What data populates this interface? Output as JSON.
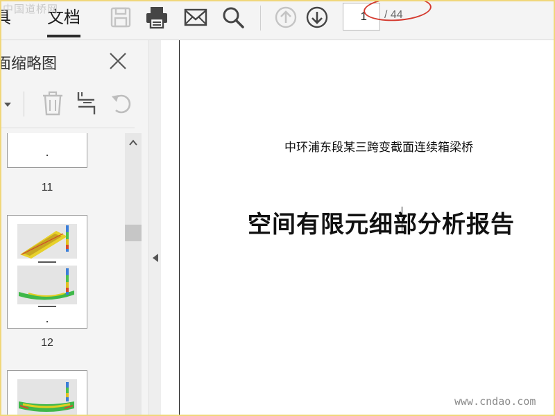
{
  "watermark_top": "中国道桥网",
  "watermark_bottom": "www.cndao.com",
  "menu": {
    "tools_label": "具",
    "document_label": "文档"
  },
  "toolbar_icons": [
    "save-icon",
    "print-icon",
    "mail-icon",
    "search-icon",
    "arrow-up-icon",
    "arrow-down-icon"
  ],
  "pager": {
    "current_page": "1",
    "total_pages": "/ 44"
  },
  "thumbnail_panel": {
    "title": "面缩略图",
    "pages": [
      {
        "number": "11"
      },
      {
        "number": "12"
      }
    ]
  },
  "document": {
    "subtitle": "中环浦东段某三跨变截面连续箱梁桥",
    "title": "空间有限元细部分析报告"
  },
  "colors": {
    "toolbar_bg": "#f4f4f4",
    "annotation_red": "#d43a2f",
    "frame_yellow": "#f0d77a"
  }
}
